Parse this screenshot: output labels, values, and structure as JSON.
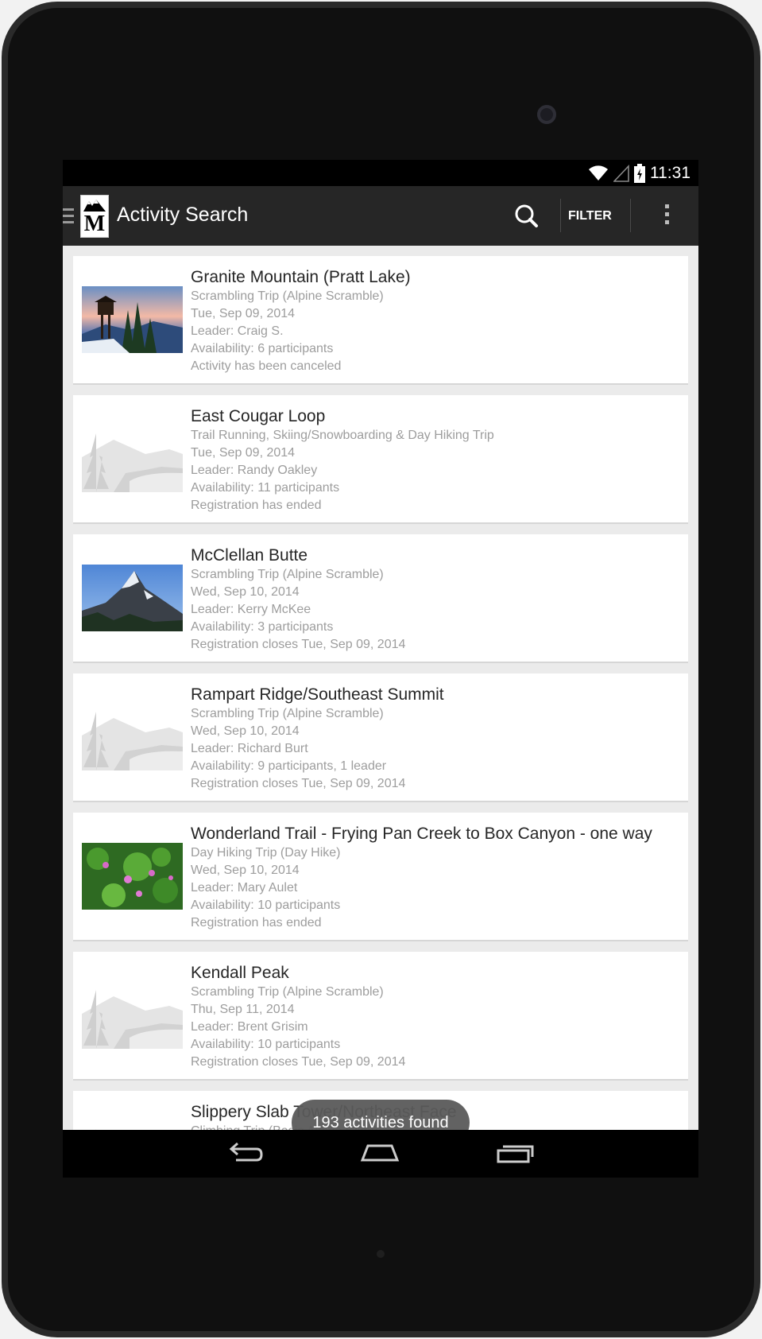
{
  "status_bar": {
    "time": "11:31"
  },
  "action_bar": {
    "title": "Activity Search",
    "filter_label": "FILTER"
  },
  "activities": [
    {
      "title": "Granite Mountain (Pratt Lake)",
      "type": "Scrambling Trip (Alpine Scramble)",
      "date": "Tue, Sep 09, 2014",
      "leader": "Leader: Craig S.",
      "availability": "Availability: 6 participants",
      "status": "Activity has been canceled",
      "thumbnail": "lookout-photo"
    },
    {
      "title": "East Cougar Loop",
      "type": "Trail Running, Skiing/Snowboarding & Day Hiking Trip",
      "date": "Tue, Sep 09, 2014",
      "leader": "Leader: Randy Oakley",
      "availability": "Availability: 11 participants",
      "status": "Registration has ended",
      "thumbnail": "placeholder-landscape"
    },
    {
      "title": "McClellan Butte",
      "type": "Scrambling Trip (Alpine Scramble)",
      "date": "Wed, Sep 10, 2014",
      "leader": "Leader: Kerry McKee",
      "availability": "Availability: 3 participants",
      "status": "Registration closes Tue, Sep 09, 2014",
      "thumbnail": "peak-photo"
    },
    {
      "title": "Rampart Ridge/Southeast Summit",
      "type": "Scrambling Trip (Alpine Scramble)",
      "date": "Wed, Sep 10, 2014",
      "leader": "Leader: Richard Burt",
      "availability": "Availability: 9 participants, 1 leader",
      "status": "Registration closes Tue, Sep 09, 2014",
      "thumbnail": "placeholder-landscape"
    },
    {
      "title": "Wonderland Trail - Frying Pan Creek to Box Canyon - one way",
      "type": "Day Hiking Trip (Day Hike)",
      "date": "Wed, Sep 10, 2014",
      "leader": "Leader: Mary Aulet",
      "availability": "Availability: 10 participants",
      "status": "Registration has ended",
      "thumbnail": "flowers-photo"
    },
    {
      "title": "Kendall Peak",
      "type": "Scrambling Trip (Alpine Scramble)",
      "date": "Thu, Sep 11, 2014",
      "leader": "Leader: Brent Grisim",
      "availability": "Availability: 10 participants",
      "status": "Registration closes Tue, Sep 09, 2014",
      "thumbnail": "placeholder-landscape"
    },
    {
      "title": "Slippery Slab Tower/Northeast Face",
      "type": "Climbing Trip (Basic Alpine Climb)",
      "date": "",
      "leader": "",
      "availability": "",
      "status": "",
      "thumbnail": "placeholder-landscape"
    }
  ],
  "toast": {
    "message": "193 activities found"
  },
  "colors": {
    "action_bar": "#262626",
    "list_background": "#ebebeb",
    "title_text": "#262626",
    "detail_text": "#9d9d9d"
  },
  "icons": [
    "drawer-icon",
    "search-icon",
    "overflow-menu-icon",
    "back-icon",
    "home-icon",
    "recents-icon",
    "wifi-icon",
    "signal-icon",
    "battery-icon"
  ]
}
